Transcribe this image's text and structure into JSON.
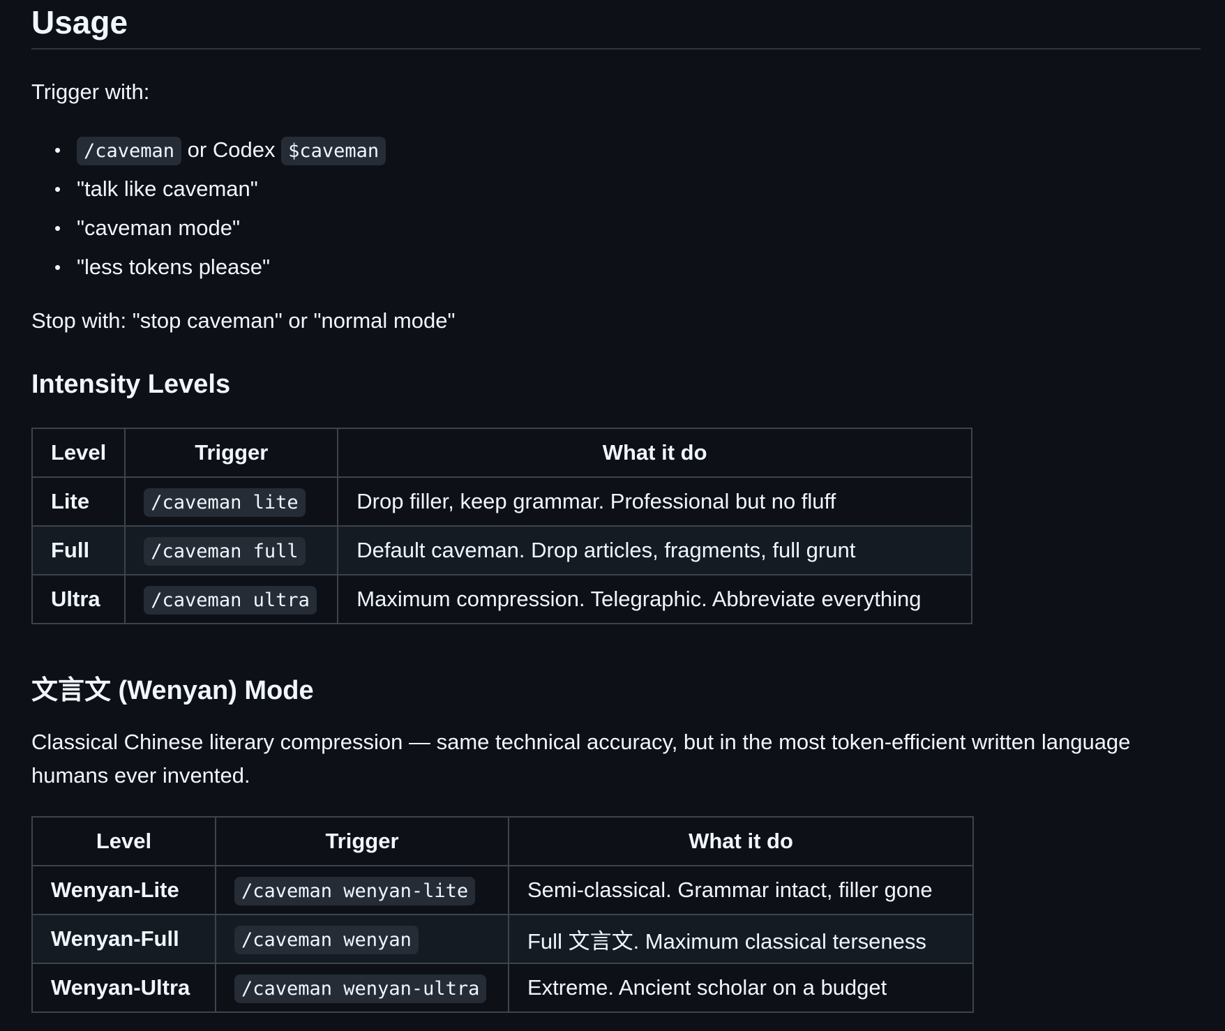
{
  "usage": {
    "title": "Usage",
    "trigger_intro": "Trigger with:",
    "triggers": [
      {
        "code": "/caveman",
        "middle": " or Codex ",
        "code2": "$caveman"
      },
      {
        "text": "\"talk like caveman\""
      },
      {
        "text": "\"caveman mode\""
      },
      {
        "text": "\"less tokens please\""
      }
    ],
    "stop_text": "Stop with: \"stop caveman\" or \"normal mode\""
  },
  "intensity": {
    "title": "Intensity Levels",
    "headers": [
      "Level",
      "Trigger",
      "What it do"
    ],
    "rows": [
      {
        "level": "Lite",
        "trigger": "/caveman lite",
        "desc": "Drop filler, keep grammar. Professional but no fluff"
      },
      {
        "level": "Full",
        "trigger": "/caveman full",
        "desc": "Default caveman. Drop articles, fragments, full grunt"
      },
      {
        "level": "Ultra",
        "trigger": "/caveman ultra",
        "desc": "Maximum compression. Telegraphic. Abbreviate everything"
      }
    ]
  },
  "wenyan": {
    "title": "文言文 (Wenyan) Mode",
    "description": "Classical Chinese literary compression — same technical accuracy, but in the most token-efficient written language humans ever invented.",
    "headers": [
      "Level",
      "Trigger",
      "What it do"
    ],
    "rows": [
      {
        "level": "Wenyan-Lite",
        "trigger": "/caveman wenyan-lite",
        "desc": "Semi-classical. Grammar intact, filler gone"
      },
      {
        "level": "Wenyan-Full",
        "trigger": "/caveman wenyan",
        "desc": "Full 文言文. Maximum classical terseness"
      },
      {
        "level": "Wenyan-Ultra",
        "trigger": "/caveman wenyan-ultra",
        "desc": "Extreme. Ancient scholar on a budget"
      }
    ]
  }
}
